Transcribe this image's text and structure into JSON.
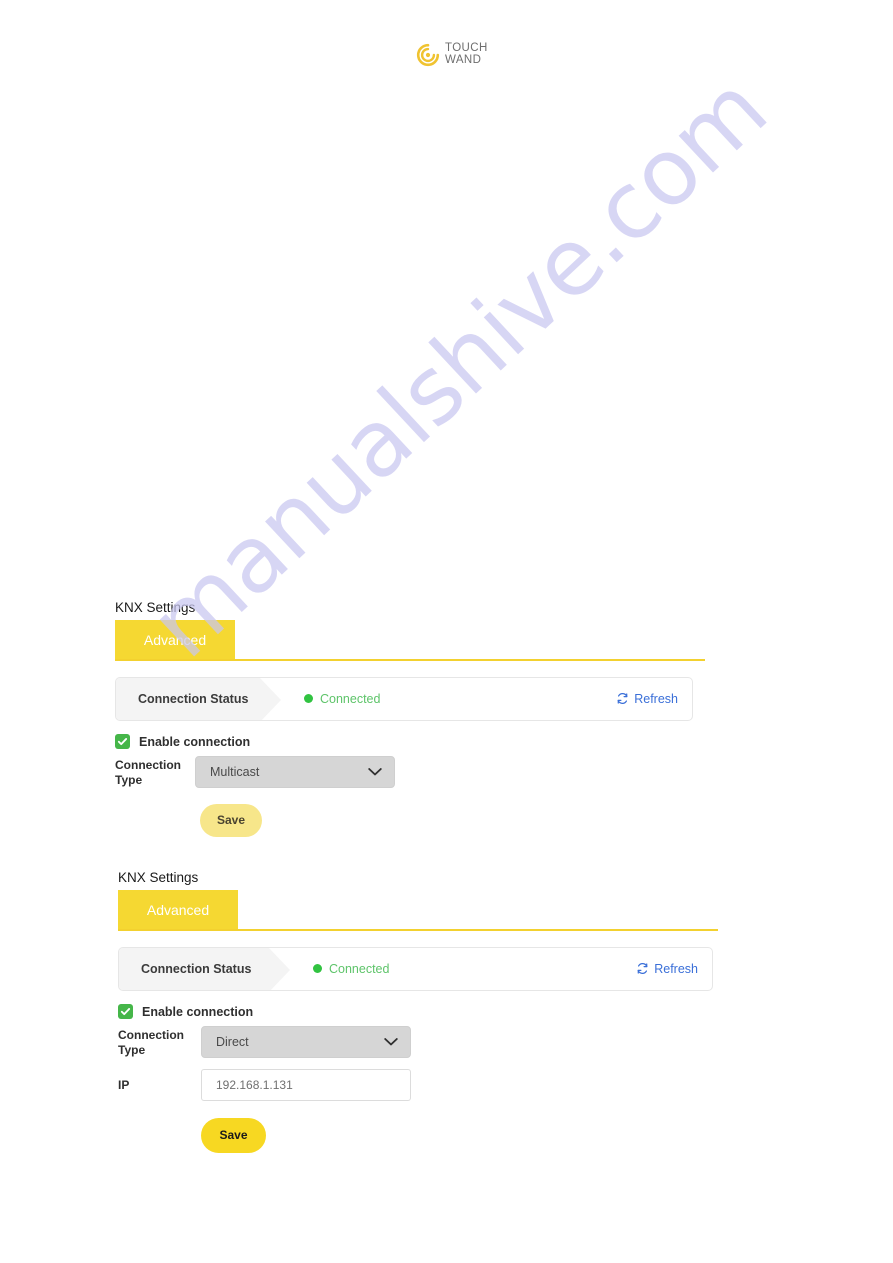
{
  "logo": {
    "icon": "touchwand-spiral-icon",
    "line1": "TOUCH",
    "line2": "WAND"
  },
  "watermark": {
    "text": "manualshive.com",
    "color": "#c9c7f0"
  },
  "colors": {
    "accent_yellow": "#f5d832",
    "underline_yellow": "#f3d12f",
    "status_green": "#31c341",
    "status_text_green": "#5ec46a",
    "checkbox_green": "#45b649",
    "link_blue": "#3a6fd8",
    "select_grey": "#d6d6d6"
  },
  "sections": [
    {
      "title": "KNX Settings",
      "tab_label": "Advanced",
      "status": {
        "chip_label": "Connection Status",
        "value": "Connected",
        "refresh_label": "Refresh",
        "refresh_icon": "sync-refresh-icon",
        "dot_icon": "status-dot-icon"
      },
      "enable": {
        "label": "Enable connection",
        "checked": true,
        "check_icon": "checkmark-icon"
      },
      "connection_type": {
        "label_line1": "Connection",
        "label_line2": "Type",
        "value": "Multicast",
        "caret_icon": "chevron-down-icon",
        "options": [
          "Multicast",
          "Direct"
        ]
      },
      "ip": null,
      "save_label": "Save"
    },
    {
      "title": "KNX Settings",
      "tab_label": "Advanced",
      "status": {
        "chip_label": "Connection Status",
        "value": "Connected",
        "refresh_label": "Refresh",
        "refresh_icon": "sync-refresh-icon",
        "dot_icon": "status-dot-icon"
      },
      "enable": {
        "label": "Enable connection",
        "checked": true,
        "check_icon": "checkmark-icon"
      },
      "connection_type": {
        "label_line1": "Connection",
        "label_line2": "Type",
        "value": "Direct",
        "caret_icon": "chevron-down-icon",
        "options": [
          "Multicast",
          "Direct"
        ]
      },
      "ip": {
        "label": "IP",
        "value": "192.168.1.131"
      },
      "save_label": "Save"
    }
  ]
}
